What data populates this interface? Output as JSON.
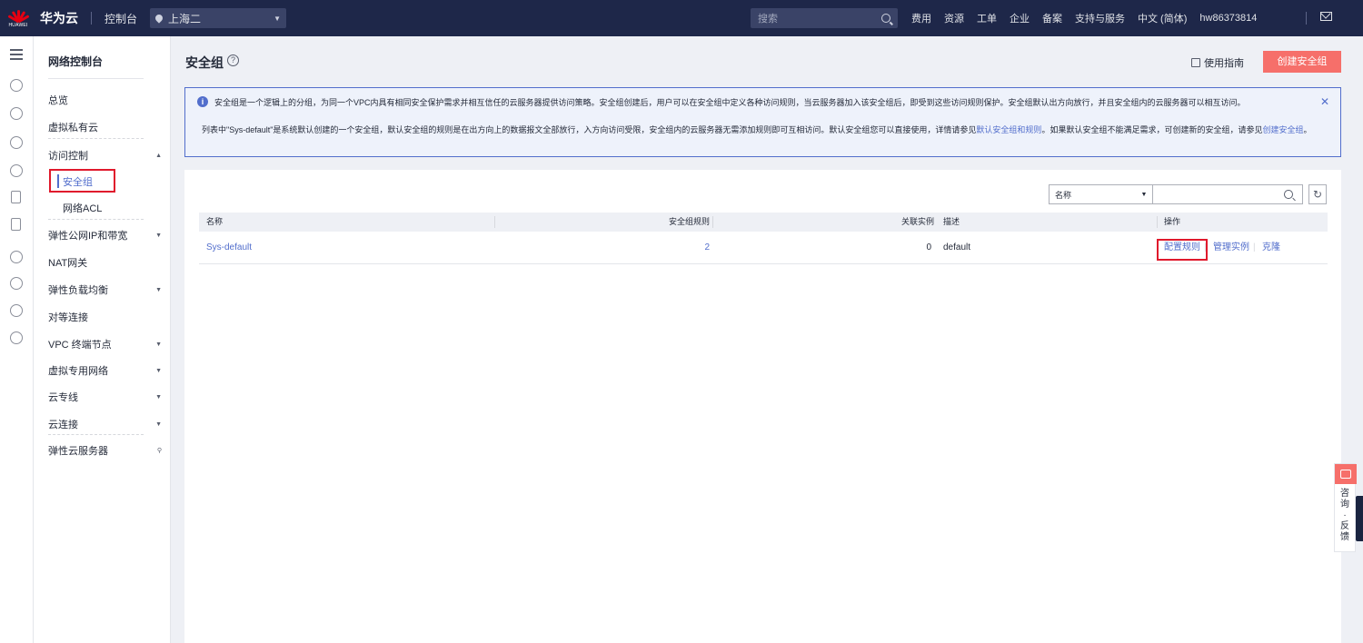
{
  "topbar": {
    "logo_text": "HUAWEI",
    "brand": "华为云",
    "console": "控制台",
    "region": "上海二",
    "search_placeholder": "搜索",
    "nav": [
      "费用",
      "资源",
      "工单",
      "企业",
      "备案",
      "支持与服务",
      "中文 (简体)",
      "hw86373814"
    ]
  },
  "sidebar": {
    "title": "网络控制台",
    "items": [
      {
        "label": "总览"
      },
      {
        "label": "虚拟私有云"
      },
      {
        "label": "访问控制",
        "expanded": true
      },
      {
        "label": "安全组",
        "active": true
      },
      {
        "label": "网络ACL"
      },
      {
        "label": "弹性公网IP和带宽"
      },
      {
        "label": "NAT网关"
      },
      {
        "label": "弹性负载均衡"
      },
      {
        "label": "对等连接"
      },
      {
        "label": "VPC 终端节点"
      },
      {
        "label": "虚拟专用网络"
      },
      {
        "label": "云专线"
      },
      {
        "label": "云连接"
      },
      {
        "label": "弹性云服务器"
      }
    ]
  },
  "page": {
    "title": "安全组",
    "help": "?",
    "guide": "使用指南",
    "create_button": "创建安全组"
  },
  "notice": {
    "line1": "安全组是一个逻辑上的分组，为同一个VPC内具有相同安全保护需求并相互信任的云服务器提供访问策略。安全组创建后，用户可以在安全组中定义各种访问规则，当云服务器加入该安全组后，即受到这些访问规则保护。安全组默认出方向放行，并且安全组内的云服务器可以相互访问。",
    "line2_a": "列表中\"Sys-default\"是系统默认创建的一个安全组，默认安全组的规则是在出方向上的数据报文全部放行，入方向访问受限，安全组内的云服务器无需添加规则即可互相访问。默认安全组您可以直接使用，详情请参见",
    "line2_link1": "默认安全组和规则",
    "line2_b": "。如果默认安全组不能满足需求，可创建新的安全组，请参见",
    "line2_link2": "创建安全组",
    "line2_c": "。",
    "close": "✕"
  },
  "filter": {
    "field": "名称",
    "value": ""
  },
  "table": {
    "columns": [
      "名称",
      "安全组规则",
      "关联实例",
      "描述",
      "操作"
    ],
    "rows": [
      {
        "name": "Sys-default",
        "rules": "2",
        "instances": "0",
        "description": "default",
        "actions": [
          "配置规则",
          "管理实例",
          "克隆"
        ]
      }
    ]
  },
  "float_feedback": "咨询·反馈",
  "colors": {
    "topbar": "#1e2749",
    "accent": "#526ecc",
    "primary_button": "#f66f6a",
    "highlight_box": "#e0192c"
  }
}
